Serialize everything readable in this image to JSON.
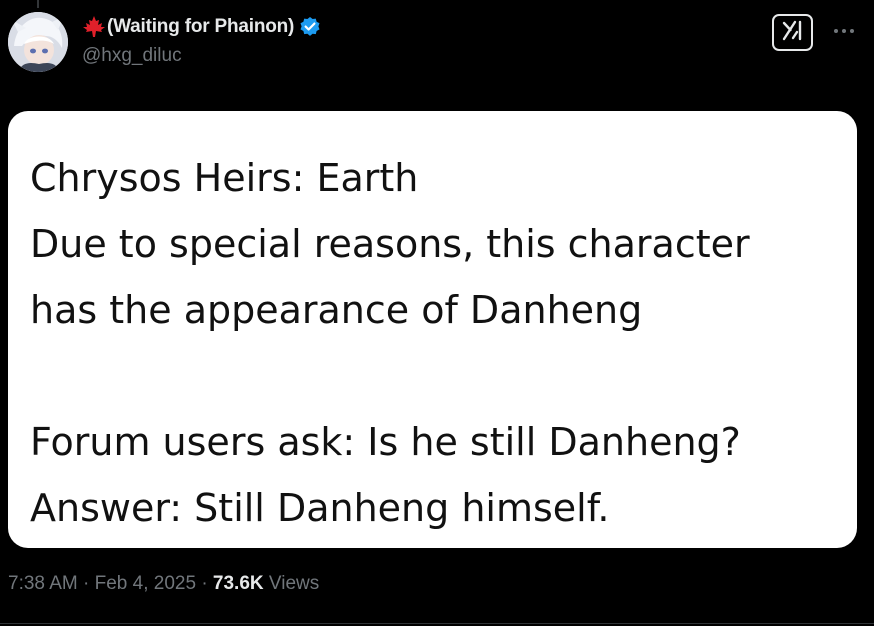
{
  "tweet": {
    "display_name": "(Waiting for Phainon)",
    "handle": "@hxg_diluc",
    "flag_icon": "maple-leaf-icon",
    "verified": true,
    "accent_color": "#1d9bf0"
  },
  "actions": {
    "grok_icon": "grok-icon",
    "more_icon": "more-horizontal-icon"
  },
  "media": {
    "lines": [
      "Chrysos Heirs: Earth",
      "Due to special reasons, this character",
      "has the appearance of Danheng",
      "",
      "Forum users ask: Is he still Danheng?",
      "Answer: Still Danheng himself."
    ]
  },
  "meta": {
    "time": "7:38 AM",
    "separator": "·",
    "date": "Feb 4, 2025",
    "views_count": "73.6K",
    "views_label": "Views"
  }
}
